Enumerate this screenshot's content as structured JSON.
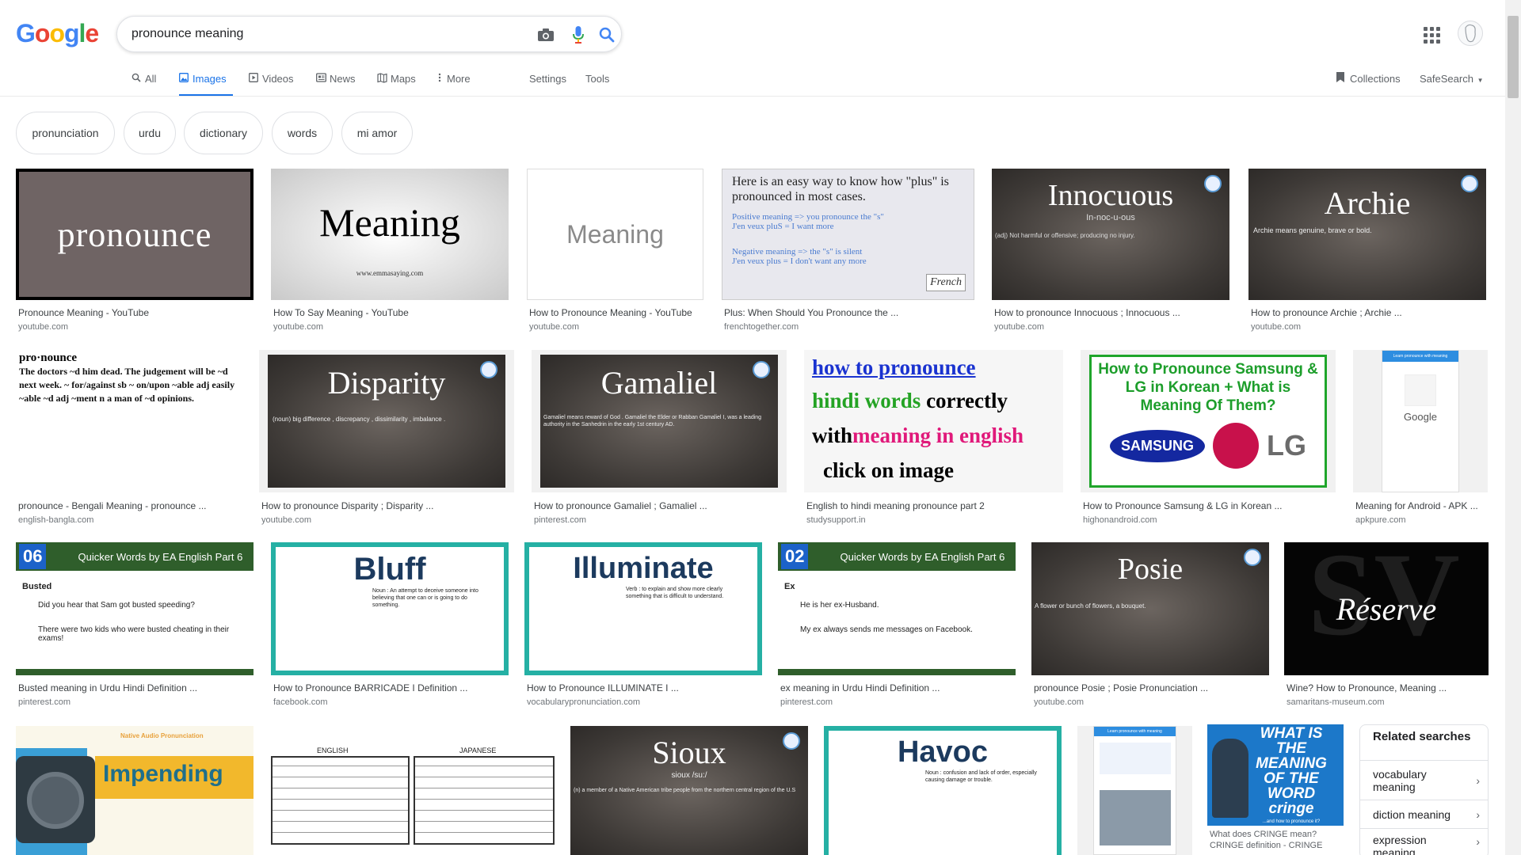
{
  "search": {
    "query": "pronounce meaning",
    "logo_letters": [
      {
        "ch": "G",
        "color": "#4285F4"
      },
      {
        "ch": "o",
        "color": "#EA4335"
      },
      {
        "ch": "o",
        "color": "#FBBC05"
      },
      {
        "ch": "g",
        "color": "#4285F4"
      },
      {
        "ch": "l",
        "color": "#34A853"
      },
      {
        "ch": "e",
        "color": "#EA4335"
      }
    ],
    "icons": [
      "camera-icon",
      "microphone-icon",
      "search-icon"
    ]
  },
  "nav": {
    "tabs": [
      {
        "label": "All",
        "icon": "search-icon",
        "active": false
      },
      {
        "label": "Images",
        "icon": "image-icon",
        "active": true
      },
      {
        "label": "Videos",
        "icon": "video-icon",
        "active": false
      },
      {
        "label": "News",
        "icon": "news-icon",
        "active": false
      },
      {
        "label": "Maps",
        "icon": "map-icon",
        "active": false
      },
      {
        "label": "More",
        "icon": "more-vert-icon",
        "active": false
      }
    ],
    "settings": "Settings",
    "tools": "Tools",
    "collections": "Collections",
    "safesearch": "SafeSearch"
  },
  "chips": [
    "pronunciation",
    "urdu",
    "dictionary",
    "words",
    "mi amor"
  ],
  "results": [
    {
      "caption": "Pronounce Meaning - YouTube",
      "site": "youtube.com",
      "thumb_text": "pronounce"
    },
    {
      "caption": "How To Say Meaning - YouTube",
      "site": "youtube.com",
      "thumb_text": "Meaning",
      "thumb_sub": "www.emmasaying.com"
    },
    {
      "caption": "How to Pronounce Meaning - YouTube",
      "site": "youtube.com",
      "thumb_text": "Meaning"
    },
    {
      "caption": "Plus: When Should You Pronounce the ...",
      "site": "frenchtogether.com",
      "thumb_text": "Here is an easy way to know how \"plus\" is pronounced in most cases.",
      "thumb_line1": "Positive meaning => you pronounce the \"s\"",
      "thumb_line2": "J'en veux pluS = I want more",
      "thumb_line3": "Negative meaning => the \"s\" is silent",
      "thumb_line4": "J'en veux plus = I don't want any more",
      "thumb_logo": "French"
    },
    {
      "caption": "How to pronounce Innocuous ; Innocuous ...",
      "site": "youtube.com",
      "thumb_text": "Innocuous",
      "thumb_sub": "In-noc-u-ous",
      "thumb_def": "(adj) Not harmful or offensive; producing no injury."
    },
    {
      "caption": "How to pronounce Archie ; Archie ...",
      "site": "youtube.com",
      "thumb_text": "Archie",
      "thumb_def": "Archie means genuine, brave or bold."
    },
    {
      "caption": "pronounce - Bengali Meaning - pronounce ...",
      "site": "english-bangla.com",
      "thumb_text": "pro·nounce",
      "thumb_def": "The doctors ~d him dead. The judgement will be ~d next week. ~ for/against sb ~ on/upon ~able adj easily ~able ~d adj ~ment n a man of ~d opinions."
    },
    {
      "caption": "How to pronounce Disparity ; Disparity ...",
      "site": "youtube.com",
      "thumb_text": "Disparity",
      "thumb_def": "(noun) big difference , discrepancy , dissimilarity , imbalance ."
    },
    {
      "caption": "How to pronounce Gamaliel ; Gamaliel ...",
      "site": "pinterest.com",
      "thumb_text": "Gamaliel",
      "thumb_def": "Gamaliel means reward of God . Gamaliel the Elder or Rabban Gamaliel I, was a leading authority in the Sanhedrin in the early 1st century AD."
    },
    {
      "caption": "English to hindi meaning pronounce part 2",
      "site": "studysupport.in",
      "thumb_line1": "how to pronounce",
      "thumb_line2a": "hindi words",
      "thumb_line2b": " correctly",
      "thumb_line3a": "with",
      "thumb_line3b": "meaning in english",
      "thumb_line4": "click on image"
    },
    {
      "caption": "How to Pronounce Samsung & LG in Korean ...",
      "site": "highonandroid.com",
      "thumb_text": "How to Pronounce Samsung & LG in Korean + What is Meaning Of Them?",
      "thumb_brand1": "SAMSUNG",
      "thumb_brand2": "LG"
    },
    {
      "caption": "Meaning for Android - APK ...",
      "site": "apkpure.com",
      "thumb_text": "Google",
      "thumb_sub": "Learn pronounce with meaning"
    },
    {
      "caption": "Busted meaning in Urdu Hindi Definition ...",
      "site": "pinterest.com",
      "thumb_num": "06",
      "thumb_title": "Quicker Words by EA English Part 6",
      "thumb_word": "Busted",
      "thumb_ex1": "Did you hear that Sam got busted speeding?",
      "thumb_ex2": "There were two kids who were busted cheating in their exams!"
    },
    {
      "caption": "How to Pronounce BARRICADE I Definition ...",
      "site": "facebook.com",
      "thumb_text": "Bluff",
      "thumb_def": "Noun : An attempt to deceive someone into believing that one can or is going to do something."
    },
    {
      "caption": "How to Pronounce ILLUMINATE I ...",
      "site": "vocabularypronunciation.com",
      "thumb_text": "Illuminate",
      "thumb_def": "Verb : to explain and show more clearly something that is difficult to understand."
    },
    {
      "caption": "ex meaning in Urdu Hindi Definition ...",
      "site": "pinterest.com",
      "thumb_num": "02",
      "thumb_title": "Quicker Words by EA English Part 6",
      "thumb_word": "Ex",
      "thumb_ex1": "He is her ex-Husband.",
      "thumb_ex2": "My ex always sends me messages on Facebook."
    },
    {
      "caption": "pronounce Posie ; Posie Pronunciation ...",
      "site": "youtube.com",
      "thumb_text": "Posie",
      "thumb_def": "A flower or bunch of flowers, a bouquet."
    },
    {
      "caption": "Wine? How to Pronounce, Meaning ...",
      "site": "samaritans-museum.com",
      "thumb_text": "Réserve"
    },
    {
      "thumb_text": "Impending",
      "thumb_sub": "Native Audio Pronunciation"
    },
    {
      "thumb_text": "ENGLISH",
      "thumb_sub": "JAPANESE"
    },
    {
      "thumb_text": "Sioux",
      "thumb_sub": "sioux /su:/",
      "thumb_def": "(n) a member of a Native American tribe people from the northern central region of the U.S"
    },
    {
      "thumb_text": "Havoc",
      "thumb_def": "Noun : confusion and lack of order, especially causing damage or trouble."
    },
    {
      "thumb_text": "Learn pronounce with meaning"
    },
    {
      "caption": "What does CRINGE mean? CRINGE definition - CRINGE",
      "thumb_text": "WHAT IS THE MEANING OF THE WORD cringe",
      "thumb_sub": "...and how to pronounce it?"
    }
  ],
  "related": {
    "title": "Related searches",
    "items": [
      "vocabulary meaning",
      "diction meaning",
      "expression meaning"
    ]
  }
}
